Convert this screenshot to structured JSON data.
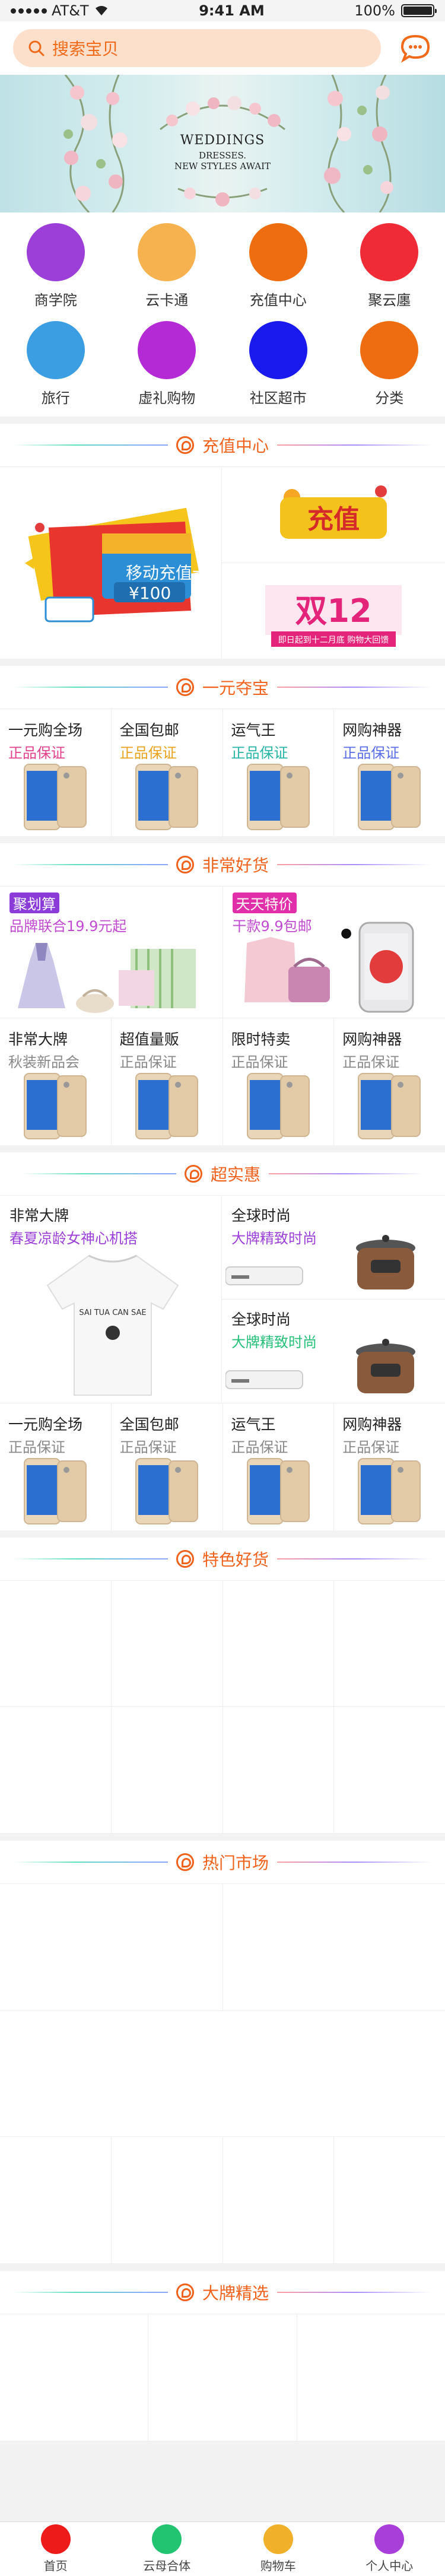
{
  "status": {
    "carrier": "AT&T",
    "time": "9:41 AM",
    "battery": "100%"
  },
  "search": {
    "placeholder": "搜索宝贝"
  },
  "banner": {
    "line1": "WEDDINGS",
    "line2": "DRESSES.",
    "line3": "NEW STYLES AWAIT"
  },
  "menu": [
    {
      "label": "商学院",
      "color": "#9b3fd8"
    },
    {
      "label": "云卡通",
      "color": "#f6b24f"
    },
    {
      "label": "充值中心",
      "color": "#ee6d10"
    },
    {
      "label": "聚云廛",
      "color": "#ee2b37"
    },
    {
      "label": "旅行",
      "color": "#3c9ee2"
    },
    {
      "label": "虚礼购物",
      "color": "#b42bd6"
    },
    {
      "label": "社区超市",
      "color": "#1a1aee"
    },
    {
      "label": "分类",
      "color": "#ee6d10"
    }
  ],
  "sections": {
    "recharge": "充值中心",
    "yiyuan": "一元夺宝",
    "feichang": "非常好货",
    "chaoshi": "超实惠",
    "tese": "特色好货",
    "remen": "热门市场",
    "dapai": "大牌精选"
  },
  "recharge": {
    "card_amount": "¥100",
    "card_text": "移动充值卡",
    "promo1": "充值",
    "promo2": "双12",
    "promo_sub": "即日起到十二月底 购物大回馈"
  },
  "yiyuan_items": [
    {
      "name": "一元购全场",
      "sub": "正品保证",
      "color": "#e0418a"
    },
    {
      "name": "全国包邮",
      "sub": "正品保证",
      "color": "#e8a21b"
    },
    {
      "name": "运气王",
      "sub": "正品保证",
      "color": "#26b5a6"
    },
    {
      "name": "网购神器",
      "sub": "正品保证",
      "color": "#5a6ce8"
    }
  ],
  "feichang_big": [
    {
      "tag": "聚划算",
      "tag_color": "#8a3bd8",
      "sub": "品牌联合19.9元起",
      "sub_color": "#c04ad0"
    },
    {
      "tag": "天天特价",
      "tag_color": "#e02fa8",
      "sub": "干款9.9包邮",
      "sub_color": "#c04ad0"
    }
  ],
  "feichang_items": [
    {
      "name": "非常大牌",
      "sub": "秋装新品会"
    },
    {
      "name": "超值量贩",
      "sub": "正品保证"
    },
    {
      "name": "限时特卖",
      "sub": "正品保证"
    },
    {
      "name": "网购神器",
      "sub": "正品保证"
    }
  ],
  "chaoshi": {
    "left_title": "非常大牌",
    "left_sub": "春夏凉龄女神心机搭",
    "tshirt_text": "SAI TUA CAN SAE",
    "r1_title": "全球时尚",
    "r1_sub": "大牌精致时尚",
    "r2_title": "全球时尚",
    "r2_sub": "大牌精致时尚"
  },
  "chaoshi_items": [
    {
      "name": "一元购全场",
      "sub": "正品保证"
    },
    {
      "name": "全国包邮",
      "sub": "正品保证"
    },
    {
      "name": "运气王",
      "sub": "正品保证"
    },
    {
      "name": "网购神器",
      "sub": "正品保证"
    }
  ],
  "tabs": [
    {
      "label": "首页",
      "color": "#ee1b1b"
    },
    {
      "label": "云母合体",
      "color": "#22c472"
    },
    {
      "label": "购物车",
      "color": "#f0b02a"
    },
    {
      "label": "个人中心",
      "color": "#a83fd8"
    }
  ]
}
